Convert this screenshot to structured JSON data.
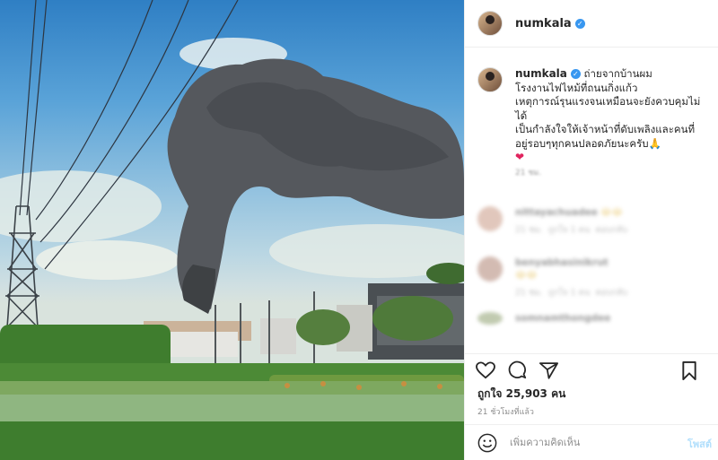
{
  "post": {
    "username": "numkala",
    "verified_mark": "✓",
    "caption": {
      "line1": "ถ่ายจากบ้านผม",
      "line2": "โรงงานไฟไหม้ที่ถนนกิ่งแก้ว",
      "line3": "เหตุการณ์รุนแรงจนเหมือนจะยังควบคุมไม่ได้",
      "line4": "เป็นกำลังใจให้เจ้าหน้าที่ดับเพลิงและคนที่อยู่รอบๆทุกคนปลอดภัยนะครับ",
      "emoji_pray": "🙏",
      "emoji_heart": "❤",
      "age": "21 ชม."
    },
    "comments": [
      {
        "user": "nittayachuadee",
        "emoji": "😂😂",
        "meta1": "21 ชม.",
        "meta2": "ถูกใจ 1 คน",
        "meta3": "ตอบกลับ"
      },
      {
        "user": "benyabhasinikrut",
        "emoji": "😂😂",
        "meta1": "21 ชม.",
        "meta2": "ถูกใจ 1 คน",
        "meta3": "ตอบกลับ"
      },
      {
        "user": "somnamthongdee",
        "emoji": "",
        "meta1": "",
        "meta2": "",
        "meta3": ""
      }
    ],
    "likes": "ถูกใจ 25,903 คน",
    "timestamp": "21 ชั่วโมงที่แล้ว",
    "add_comment_placeholder": "เพิ่มความคิดเห็น",
    "post_button": "โพสต์",
    "icons": {
      "like": "heart-icon",
      "comment": "comment-icon",
      "share": "share-icon",
      "save": "bookmark-icon",
      "emoji": "emoji-icon"
    }
  }
}
